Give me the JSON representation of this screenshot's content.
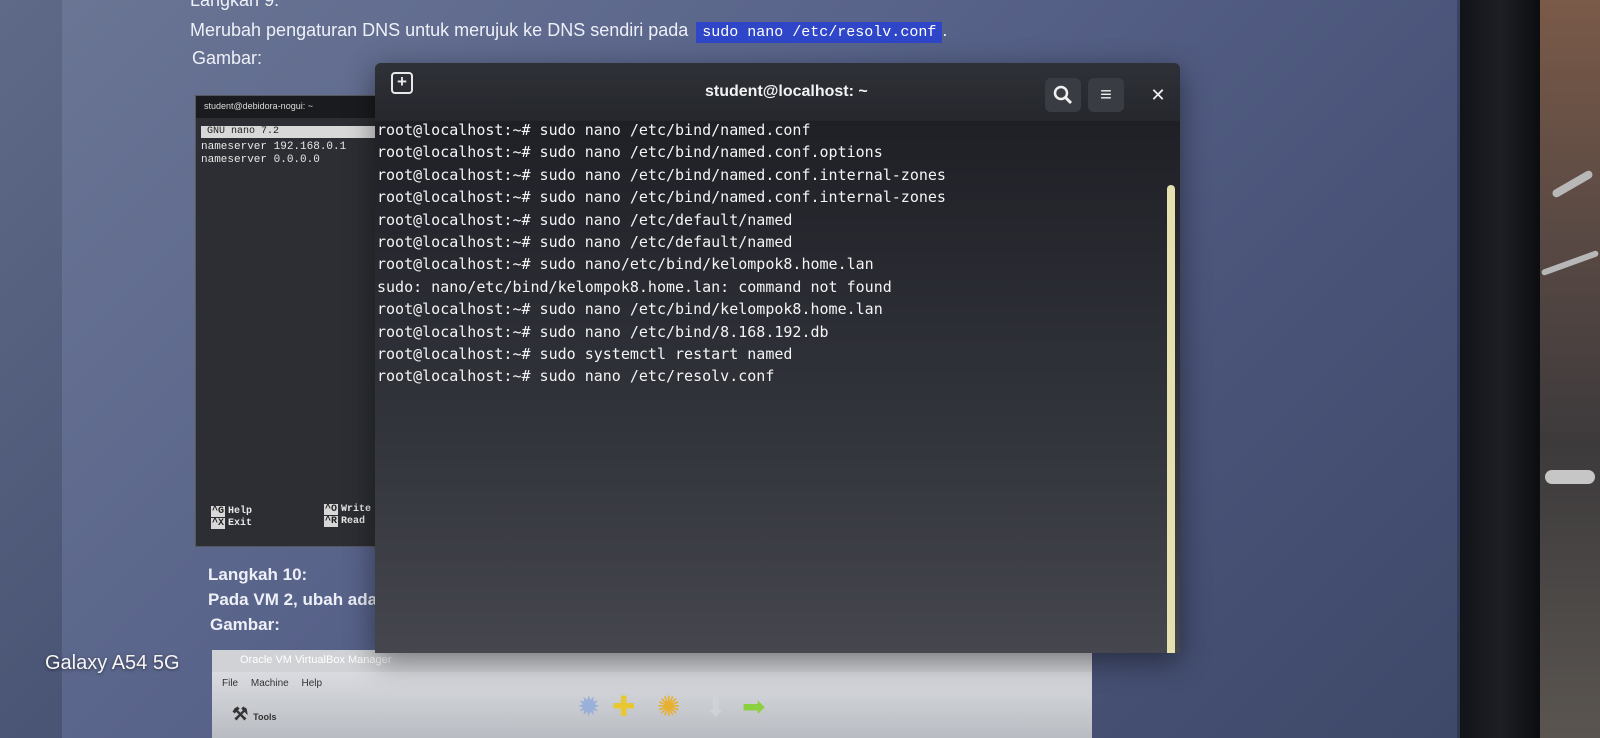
{
  "document": {
    "step9_title": "Langkah 9:",
    "step9_desc": "Merubah pengaturan DNS untuk merujuk ke DNS sendiri pada",
    "step9_code": "sudo nano /etc/resolv.conf",
    "step9_suffix": ".",
    "step9_image_label": "Gambar:",
    "step10_title": "Langkah 10:",
    "step10_desc": "Pada VM 2, ubah ada",
    "step10_image_label": "Gambar:"
  },
  "nano_screenshot": {
    "tab_title": "student@debidora-nogui: ~",
    "header": "GNU nano 7.2",
    "lines": [
      "nameserver 192.168.0.1",
      "nameserver 0.0.0.0"
    ],
    "shortcuts": [
      {
        "key": "^G",
        "label": "Help"
      },
      {
        "key": "^X",
        "label": "Exit"
      },
      {
        "key": "^O",
        "label": "Write"
      },
      {
        "key": "^R",
        "label": "Read"
      }
    ]
  },
  "terminal": {
    "title": "student@localhost: ~",
    "icons": {
      "new_tab": "new-tab-icon",
      "search": "search-icon",
      "menu": "hamburger-menu-icon",
      "close": "close-icon"
    },
    "lines": [
      "root@localhost:~# sudo nano /etc/bind/named.conf",
      "root@localhost:~# sudo nano /etc/bind/named.conf.options",
      "root@localhost:~# sudo nano /etc/bind/named.conf.internal-zones",
      "root@localhost:~# sudo nano /etc/bind/named.conf.internal-zones",
      "root@localhost:~# sudo nano /etc/default/named",
      "root@localhost:~# sudo nano /etc/default/named",
      "root@localhost:~# sudo nano/etc/bind/kelompok8.home.lan",
      "sudo: nano/etc/bind/kelompok8.home.lan: command not found",
      "root@localhost:~# sudo nano /etc/bind/kelompok8.home.lan",
      "root@localhost:~# sudo nano /etc/bind/8.168.192.db",
      "root@localhost:~# sudo systemctl restart named",
      "root@localhost:~# sudo nano /etc/resolv.conf"
    ]
  },
  "virtualbox": {
    "title": "Oracle VM VirtualBox Manager",
    "menu": [
      "File",
      "Machine",
      "Help"
    ],
    "tools_label": "Tools"
  },
  "phone_watermark": "Galaxy A54 5G",
  "colors": {
    "code_highlight": "#2f46c8",
    "terminal_bg": "#1f2026",
    "scrollbar": "#e4e0b0"
  }
}
